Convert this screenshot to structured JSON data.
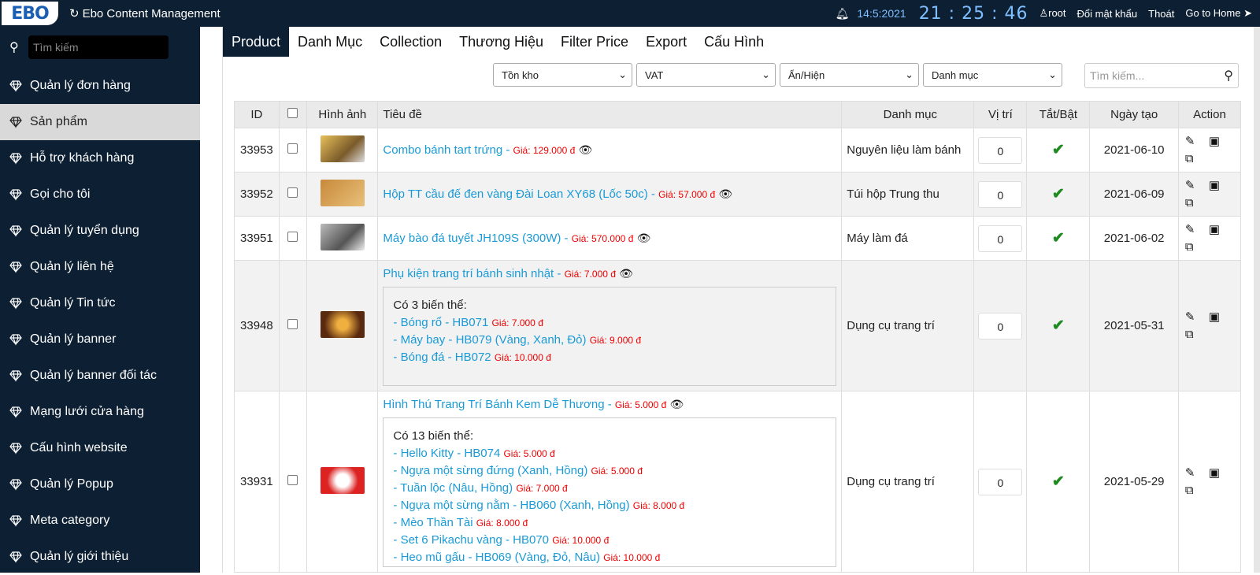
{
  "app": {
    "logo_text": "EBO",
    "title": "Ebo Content Management",
    "date": "14:5:2021",
    "clock": "21 : 25 : 46",
    "user": "root",
    "change_password": "Đổi mật khẩu",
    "logout": "Thoát",
    "go_home": "Go to Home"
  },
  "sidebar": {
    "search_placeholder": "Tìm kiếm",
    "items": [
      {
        "label": "Quản lý đơn hàng"
      },
      {
        "label": "Sản phẩm"
      },
      {
        "label": "Hỗ trợ khách hàng"
      },
      {
        "label": "Gọi cho tôi"
      },
      {
        "label": "Quản lý tuyển dụng"
      },
      {
        "label": "Quản lý liên hệ"
      },
      {
        "label": "Quản lý Tin tức"
      },
      {
        "label": "Quản lý banner"
      },
      {
        "label": "Quản lý banner đối tác"
      },
      {
        "label": "Mạng lưới cửa hàng"
      },
      {
        "label": "Cấu hình website"
      },
      {
        "label": "Quản lý Popup"
      },
      {
        "label": "Meta category"
      },
      {
        "label": "Quản lý giới thiệu"
      }
    ],
    "active_index": 1
  },
  "tabs": [
    "Product",
    "Danh Mục",
    "Collection",
    "Thương Hiệu",
    "Filter Price",
    "Export",
    "Cấu Hình"
  ],
  "filters": {
    "stock": "Tồn kho",
    "vat": "VAT",
    "visibility": "Ẩn/Hiện",
    "category": "Danh mục",
    "search_placeholder": "Tìm kiếm..."
  },
  "table": {
    "headers": [
      "ID",
      "",
      "Hình ảnh",
      "Tiêu đề",
      "Danh mục",
      "Vị trí",
      "Tắt/Bật",
      "Ngày tạo",
      "Action"
    ],
    "rows": [
      {
        "id": "33953",
        "title": "Combo bánh tart trứng -",
        "price": "Giá: 129.000 đ",
        "category": "Nguyên liệu làm bánh",
        "position": "0",
        "date": "2021-06-10"
      },
      {
        "id": "33952",
        "title": "Hộp TT cầu đế đen vàng Đài Loan XY68 (Lốc 50c) -",
        "price": "Giá: 57.000 đ",
        "category": "Túi hộp Trung thu",
        "position": "0",
        "date": "2021-06-09"
      },
      {
        "id": "33951",
        "title": "Máy bào đá tuyết JH109S (300W) -",
        "price": "Giá: 570.000 đ",
        "category": "Máy làm đá",
        "position": "0",
        "date": "2021-06-02"
      },
      {
        "id": "33948",
        "title": "Phụ kiện trang trí bánh sinh nhật -",
        "price": "Giá: 7.000 đ",
        "category": "Dụng cụ trang trí",
        "position": "0",
        "date": "2021-05-31",
        "variants_title": "Có 3 biến thể:",
        "variants": [
          {
            "name": "- Bóng rổ - HB071",
            "price": "Giá: 7.000 đ"
          },
          {
            "name": "- Máy bay - HB079 (Vàng, Xanh, Đỏ)",
            "price": "Giá: 9.000 đ"
          },
          {
            "name": "- Bóng đá - HB072",
            "price": "Giá: 10.000 đ"
          }
        ]
      },
      {
        "id": "33931",
        "title": "Hình Thú Trang Trí Bánh Kem Dễ Thương -",
        "price": "Giá: 5.000 đ",
        "category": "Dụng cụ trang trí",
        "position": "0",
        "date": "2021-05-29",
        "variants_title": "Có 13 biến thể:",
        "variants": [
          {
            "name": "- Hello Kitty - HB074",
            "price": "Giá: 5.000 đ"
          },
          {
            "name": "- Ngựa một sừng đứng (Xanh, Hồng)",
            "price": "Giá: 5.000 đ"
          },
          {
            "name": "- Tuần lộc (Nâu, Hồng)",
            "price": "Giá: 7.000 đ"
          },
          {
            "name": "- Ngựa một sừng nằm - HB060 (Xanh, Hồng)",
            "price": "Giá: 8.000 đ"
          },
          {
            "name": "- Mèo Thần Tài",
            "price": "Giá: 8.000 đ"
          },
          {
            "name": "- Set 6 Pikachu vàng - HB070",
            "price": "Giá: 10.000 đ"
          },
          {
            "name": "- Heo mũ gấu - HB069 (Vàng, Đỏ, Nâu)",
            "price": "Giá: 10.000 đ"
          }
        ]
      }
    ]
  },
  "colors": {
    "nav_bg": "#0d1f33",
    "link": "#1a9ad6",
    "price": "#ee0000",
    "check": "#1f8a1f"
  }
}
